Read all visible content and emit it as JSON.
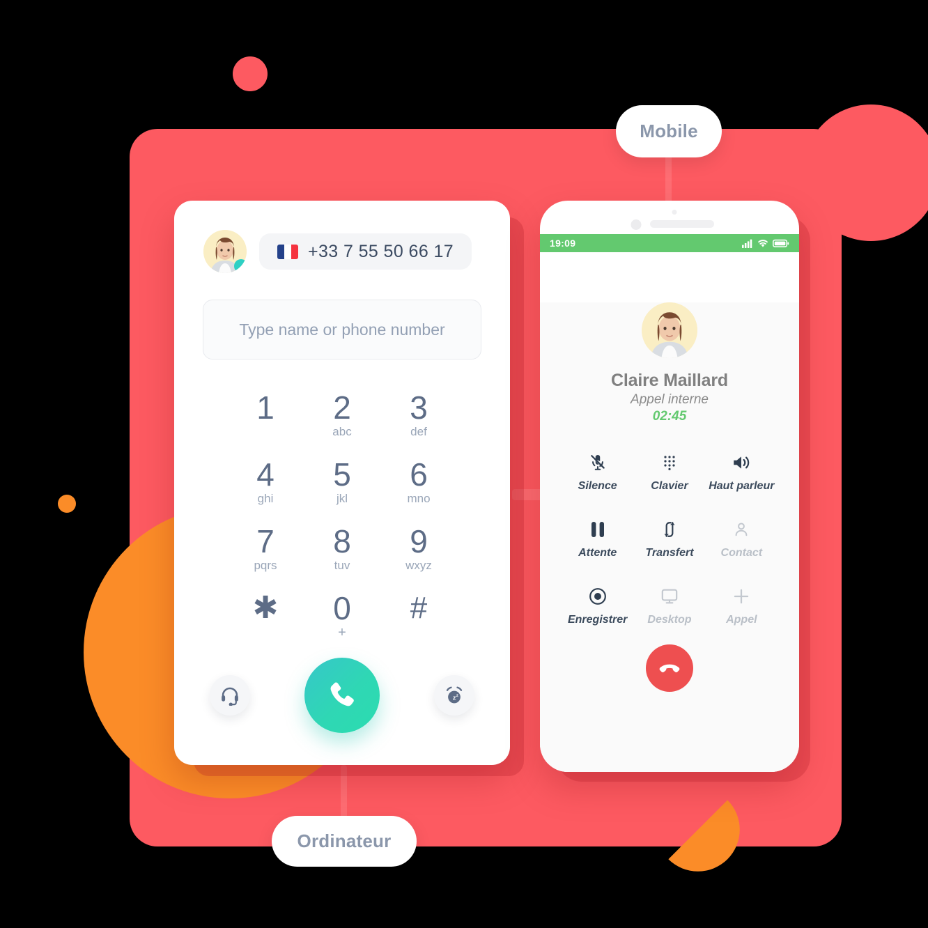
{
  "labels": {
    "mobile": "Mobile",
    "computer": "Ordinateur"
  },
  "colors": {
    "panel_red": "#fd5a61",
    "accent_orange": "#fb8c28",
    "call_green": "#2fd7b4",
    "hangup_red": "#ee4f50",
    "status_green": "#63c96f",
    "presence_teal": "#2ed0c4",
    "text_slate": "#5d6c86"
  },
  "dialer": {
    "caller_number": "+33 7 55 50 66 17",
    "flag": "fr-flag-icon",
    "search_placeholder": "Type name or phone number",
    "search_value": "",
    "keys": [
      {
        "num": "1",
        "letters": ""
      },
      {
        "num": "2",
        "letters": "abc"
      },
      {
        "num": "3",
        "letters": "def"
      },
      {
        "num": "4",
        "letters": "ghi"
      },
      {
        "num": "5",
        "letters": "jkl"
      },
      {
        "num": "6",
        "letters": "mno"
      },
      {
        "num": "7",
        "letters": "pqrs"
      },
      {
        "num": "8",
        "letters": "tuv"
      },
      {
        "num": "9",
        "letters": "wxyz"
      },
      {
        "num": "✱",
        "letters": ""
      },
      {
        "num": "0",
        "letters": "+"
      },
      {
        "num": "#",
        "letters": ""
      }
    ],
    "actions": {
      "headset": "headset-icon",
      "call": "phone-call-icon",
      "dnd": "alarm-snooze-icon"
    }
  },
  "phone": {
    "status": {
      "time": "19:09",
      "signal": "cellular-signal-icon",
      "wifi": "wifi-icon",
      "battery": "battery-icon"
    },
    "contact_name": "Claire Maillard",
    "call_type": "Appel interne",
    "duration": "02:45",
    "controls": [
      {
        "label": "Silence",
        "icon": "microphone-muted-icon",
        "enabled": true
      },
      {
        "label": "Clavier",
        "icon": "dialpad-icon",
        "enabled": true
      },
      {
        "label": "Haut parleur",
        "icon": "speaker-icon",
        "enabled": true
      },
      {
        "label": "Attente",
        "icon": "pause-icon",
        "enabled": true
      },
      {
        "label": "Transfert",
        "icon": "transfer-arrows-icon",
        "enabled": true
      },
      {
        "label": "Contact",
        "icon": "person-icon",
        "enabled": false
      },
      {
        "label": "Enregistrer",
        "icon": "record-icon",
        "enabled": true
      },
      {
        "label": "Desktop",
        "icon": "monitor-icon",
        "enabled": false
      },
      {
        "label": "Appel",
        "icon": "plus-icon",
        "enabled": false
      }
    ],
    "hangup": "hangup-phone-icon",
    "home_button": "home-button"
  }
}
